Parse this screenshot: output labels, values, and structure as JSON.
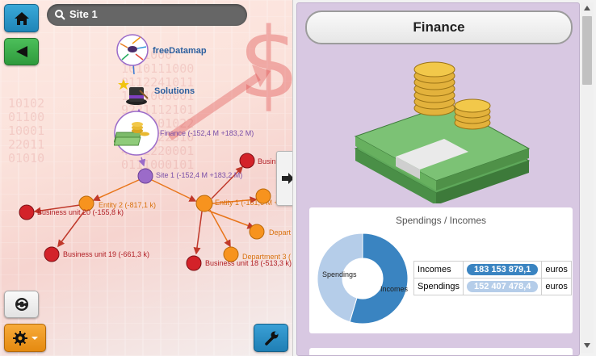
{
  "toolbar": {
    "home_icon": "home-icon",
    "back_icon": "back-arrow-icon",
    "refresh_icon": "refresh-icon",
    "settings_icon": "gear-icon",
    "tools_icon": "wrench-icon"
  },
  "search": {
    "icon": "search-icon",
    "label": "Site 1"
  },
  "map": {
    "root": "freeDatamap",
    "solutions": "Solutions",
    "finance": "Finance (-152,4 M +183,2 M)",
    "site": "Site 1 (-152,4 M +183,2 M)",
    "entity2": "Entity 2 (-817,1 k)",
    "entity1": "Entity 1 (-151,6 M +3",
    "bu20": "Business unit 20 (-155,8 k)",
    "bu19": "Business unit 19 (-661,3 k)",
    "bu18": "Business unit 18 (-513,3 k)",
    "busi_top": "Busin",
    "dept3": "Department 3 (",
    "depart": "Depart"
  },
  "panel": {
    "title": "Finance",
    "chart_title": "Spendings / Incomes"
  },
  "chart_data": {
    "type": "pie",
    "title": "Spendings / Incomes",
    "categories": [
      "Incomes",
      "Spendings"
    ],
    "values": [
      183153879.1,
      152407478.4
    ],
    "colors": [
      "#3a84c1",
      "#b5cde9"
    ],
    "labels": {
      "incomes": "Incomes",
      "spendings": "Spendings"
    }
  },
  "table": {
    "rows": [
      {
        "label": "Incomes",
        "value": "183 153 879,1",
        "unit": "euros",
        "color": "#3a84c1"
      },
      {
        "label": "Spendings",
        "value": "152 407 478,4",
        "unit": "euros",
        "color": "#b5cde9"
      }
    ]
  },
  "colors": {
    "home_button": "#2a96c6",
    "back_button": "#3aa548",
    "settings_button": "#f29a1e",
    "wrench_button": "#2a8fca",
    "orange_node": "#f7931e",
    "red_node": "#d32229",
    "purple_node": "#9b6bc9"
  }
}
